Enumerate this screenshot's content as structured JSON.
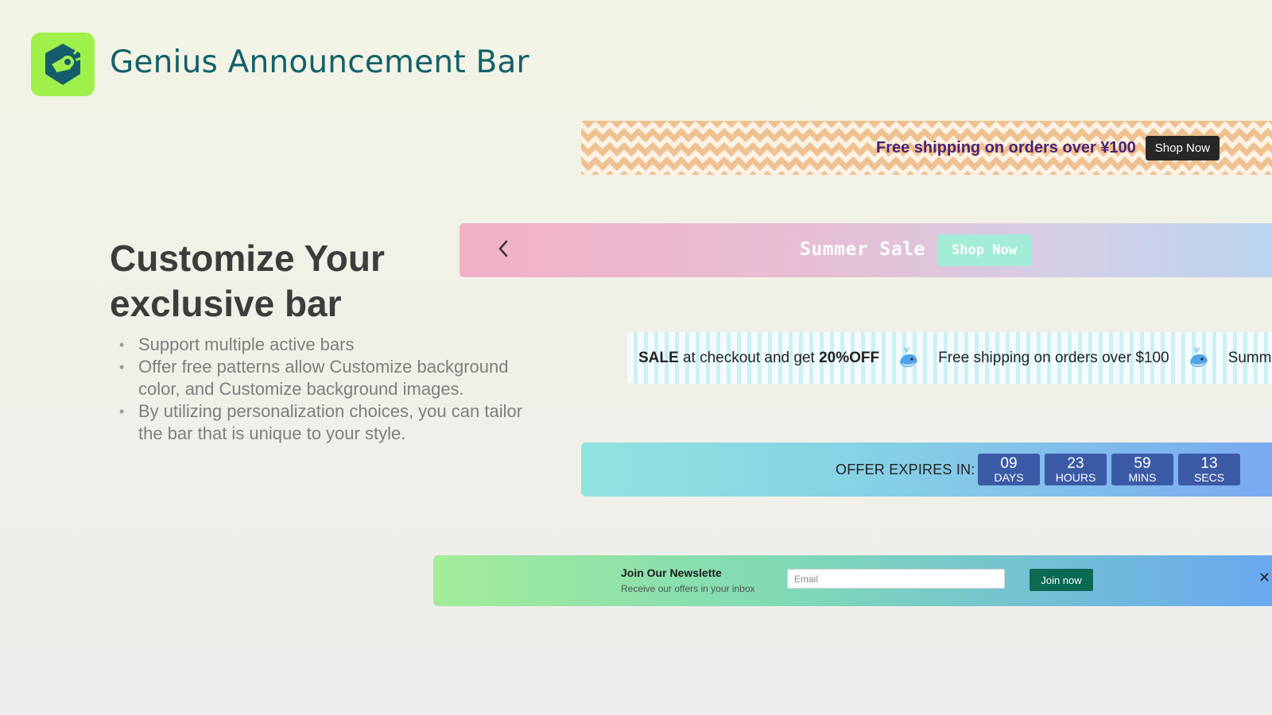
{
  "app": {
    "title": "Genius Announcement Bar",
    "logo_icon": "megaphone-icon",
    "brand_color": "#9ff04a"
  },
  "hero": {
    "heading_line1": "Customize Your",
    "heading_line2": "exclusive bar",
    "features": [
      "Support multiple active bars",
      "Offer free patterns allow Customize background color, and Customize background images.",
      "By utilizing personalization choices, you can tailor the bar that is unique to your style."
    ]
  },
  "bar_shipping": {
    "message": "Free shipping on orders over ¥100",
    "button": "Shop Now"
  },
  "bar_summer": {
    "prev_icon": "chevron-left-icon",
    "text": "Summer Sale",
    "button": "Shop Now"
  },
  "bar_marquee": {
    "item1_prefix": "SALE",
    "item1_text": " at checkout and get ",
    "item1_bold": "20%OFF",
    "item2": "Free shipping on orders over $100",
    "item3": "Summ",
    "separator_icon": "whale-icon"
  },
  "bar_countdown": {
    "label": "OFFER EXPIRES IN:",
    "units": [
      {
        "value": "09",
        "label": "DAYS"
      },
      {
        "value": "23",
        "label": "HOURS"
      },
      {
        "value": "59",
        "label": "MINS"
      },
      {
        "value": "13",
        "label": "SECS"
      }
    ]
  },
  "bar_newsletter": {
    "title": "Join Our Newslette",
    "subtitle": "Receive our offers in your inbox",
    "email_placeholder": "Email",
    "button": "Join now",
    "close_icon": "close-icon"
  }
}
